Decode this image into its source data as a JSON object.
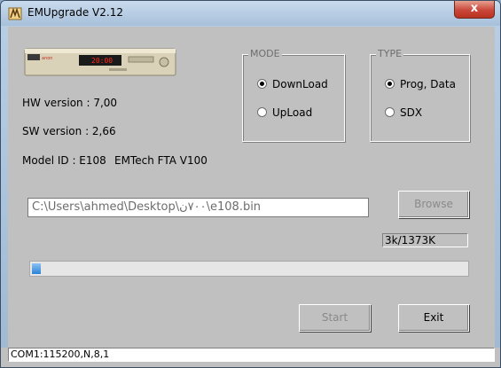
{
  "window": {
    "title": "EMUpgrade V2.12",
    "close_glyph": "x"
  },
  "info": {
    "hw_version": "HW version : 7,00",
    "sw_version": "SW version : 2,66",
    "model_id": "Model ID : E108",
    "model_name": "EMTech FTA V100"
  },
  "device": {
    "brand_text": "anon",
    "clock": "20:00"
  },
  "mode": {
    "title": "MODE",
    "options": [
      {
        "label": "DownLoad",
        "selected": true
      },
      {
        "label": "UpLoad",
        "selected": false
      }
    ]
  },
  "type": {
    "title": "TYPE",
    "options": [
      {
        "label": "Prog, Data",
        "selected": true
      },
      {
        "label": "SDX",
        "selected": false
      }
    ]
  },
  "file": {
    "path": "C:\\Users\\ahmed\\Desktop\\٧٠٠ن\\e108.bin"
  },
  "buttons": {
    "browse": "Browse",
    "start": "Start",
    "exit": "Exit"
  },
  "transfer": {
    "counter": "3k/1373K",
    "progress_fraction": 0.02
  },
  "status": {
    "port": "COM1:115200,N,8,1"
  }
}
